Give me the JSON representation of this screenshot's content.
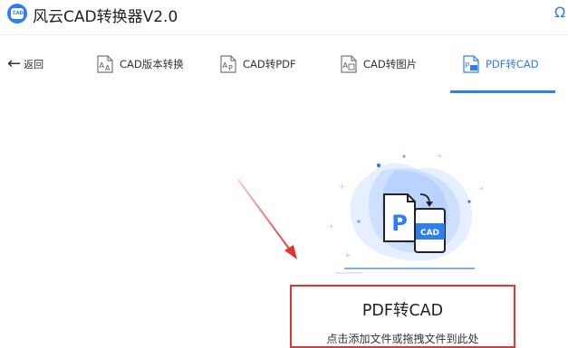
{
  "window": {
    "title": "风云CAD转换器V2.0",
    "logo_text": "CAD",
    "corner_glyph": "Ω"
  },
  "nav": {
    "back_label": "返回",
    "tabs": [
      {
        "label": "CAD版本转换",
        "icon": "cad-version-icon",
        "active": false
      },
      {
        "label": "CAD转PDF",
        "icon": "cad-to-pdf-icon",
        "active": false
      },
      {
        "label": "CAD转图片",
        "icon": "cad-to-image-icon",
        "active": false
      },
      {
        "label": "PDF转CAD",
        "icon": "pdf-to-cad-icon",
        "active": true
      }
    ]
  },
  "main": {
    "illustration": {
      "front_letter": "P",
      "back_text": "CAD"
    },
    "drop_title": "PDF转CAD",
    "drop_hint": "点击添加文件或拖拽文件到此处"
  },
  "colors": {
    "accent": "#2e7ef2",
    "highlight": "#e3342f"
  }
}
